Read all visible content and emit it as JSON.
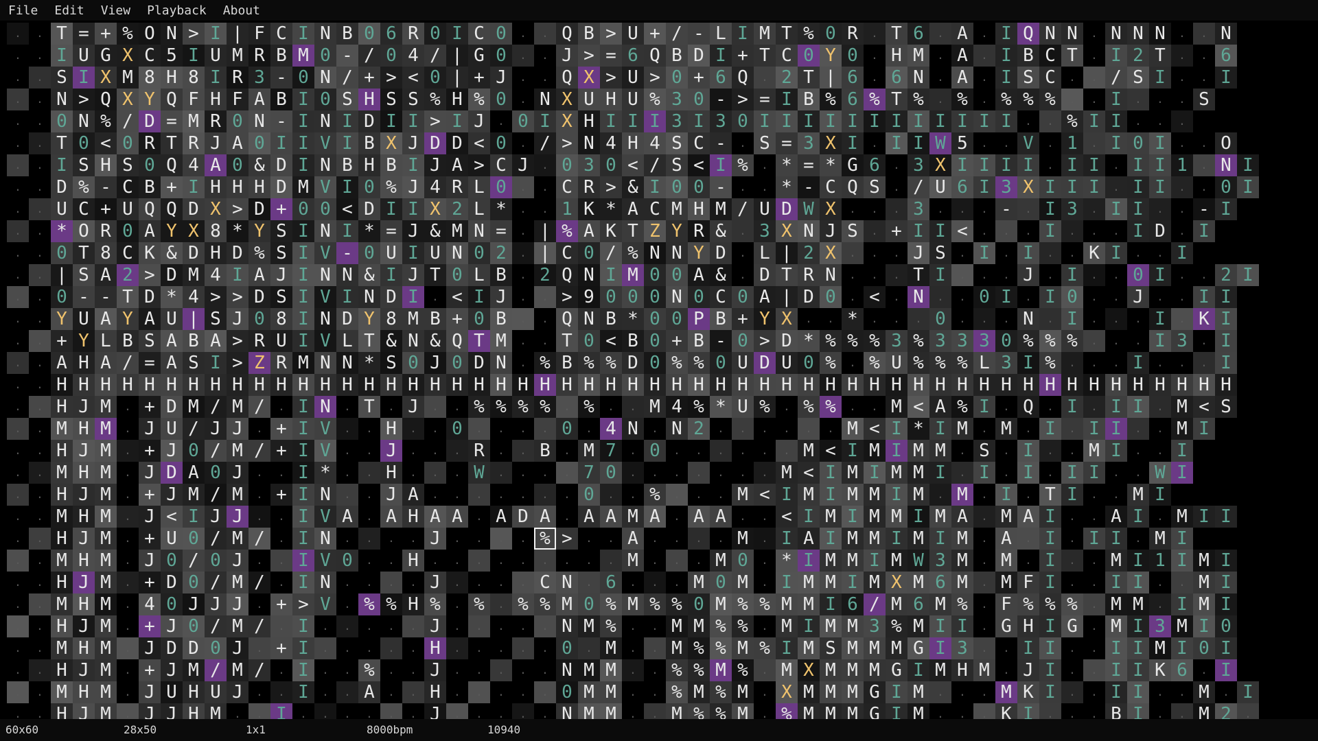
{
  "app": {
    "menus": [
      {
        "label": "File"
      },
      {
        "label": "Edit"
      },
      {
        "label": "View"
      },
      {
        "label": "Playback"
      },
      {
        "label": "About"
      }
    ]
  },
  "status": {
    "grid_size": "60x60",
    "view_size": "28x50",
    "cursor_size": "1x1",
    "tempo": "8000bpm",
    "frame": "10940"
  },
  "theme": {
    "text": "#e8e8e8",
    "text_dim": "#9a9a9a",
    "accent_teal": "#5fa796",
    "accent_yellow": "#f0c36d",
    "accent_purple": "#6b3a86"
  },
  "grid": {
    "cols": 58,
    "rows": 32,
    "cursor": {
      "col": 24,
      "row": 23
    },
    "rows_data": [
      "..T=+%ON>I|FCINB06R0IC0..QB>U+/-LIMT%0R.T6.A.IQNN.NNN..N",
      "..IUGXC5IUMRBM0-/04/|G0..J>=6QBDI+TC0Y0.HM.A.IBCT.I2T..6",
      "..SIXM8H8IR3-0N/+><0|+J..QX>U>0+6Q.2T|6.6N.A.ISC../SI..I",
      "..N>QXYQFHFABI0SHSS%H%0.NXUHU%30->=IB%6%T%.%.%%%..I...S",
      "..0N%/D=MR0N-INIDII>IJ.0IXHIII3I30IIIIIIIIIIII..%II...",
      "..T0<0RTRJA0IIVIBXJDD<0./>N4H4SC-.S=3XI.IIW5..V.1.I0I..O",
      "..ISHS0Q4A0&DINBHBIJA>CJ.030</S<I%.*=*G6.3XIIII.II.II1.NI",
      "..D%-CB+IHHHDMVI0%J4RL0..CR>&I00-..*-CQS./U6I3XIII.II..0I",
      "..UC+UQQDX>D+00<DIIX2L*..1K*ACMHM/UDWX...3...-.I3.II..-I",
      "..*OR0AYX8*YSINI*=J&MN=.|%AKTZYR&.3XNJS.+II<...I...ID.I",
      "..0T8CK&DHD%SIV-0UIUN02.|C0/%NNYD.L|2X...JS.I.I..KI..I",
      "..|SA2>DM4IAJINN&IJT0LB.2QNIM00A&.DTRN...TI...J.I..0I..2I",
      "..0--TD*4>>DSIVINDI.<IJ..>9000N0C0A|D0.<.N..0I.I0..J..II",
      "..YUAYAU|SJ08INDY8MB+0B..QNB*00PB+YX..*...0...N.I...I.KI",
      "..+YLBSABA>RUIVLT&N&QTM..T0<B0+B-0>D*%%%3%3330%%%...I3.I",
      "..AHA/=ASI>ZRMNN*S0J0DN.%B%%D0%%0UDU0%.%U%%%L3I%...I...I",
      "..HHHHHHHHHHHHHHHHHHHHHHHHHHHHHHHHHHHHHHHHHHHHHHHHHHHHHH",
      "..HJM.+DM/M/.IN.T.J..%%%%.%..M4%*U%.%%..M<A%I.Q.I.II.M<S",
      "..MHM.JU/JJ.+IV..H..0....0.4N.N2......M<I*IM.M.I.II..MI",
      "..HJM.+J0/M/+IV..J...R..B.M7.0......M<IMIMM.S.I..MI..I",
      "..MHM.JDA0J..I*..H...W....70.......M<IMIMMI.I.I.II..WI",
      "..HJM.+JM/M.+IN..JA.......0..%...M<IMIMMIM.M.I.TI..MI",
      "..MHM.J<IJJ..IVA.AHAA.ADA.AAMA.AA..<IMIMMIMA.MAI..AI.MII",
      "..HJM.+U0/M/.IN....J....%>..A....M.IAIMMIMIM.A.I.II.MI",
      "..MHM.J0/0J..IV0..H.........M...M0.*IMMIMW3M.M.I..MI1IMI",
      "..HJM.+D0/M/.IN....J....CN.6...M0M.IMMIMXM6M.MFI..II..MI",
      "..MHM.40JJJ.+>V.%%H%.%.%%M0%M%%0M%%MMI6/M6M%.F%%%.MM.IMI",
      "..HJM.+J0/M/.I.....J.....NM%..MM%%.MIMM3%MII.GHIG.MI3MI0",
      "..MHM.JDD0J.+I.....H.....0.M..M%%M%IMSMMMGI3..II..IIMI0I",
      "..HJM.+JM/M/.I..%..J.....NMM..%%M%.MXMMMGIMHM.JI..IIK6.I",
      "..MHM.JUHUJ..I..A..H.....0MM..%M%M.XMMMGIM...MKI..II..M.I",
      "..HJM.JJHM..I......J.....NMM..M%%M.%MMMGIM...KI...BI..M2."
    ]
  }
}
